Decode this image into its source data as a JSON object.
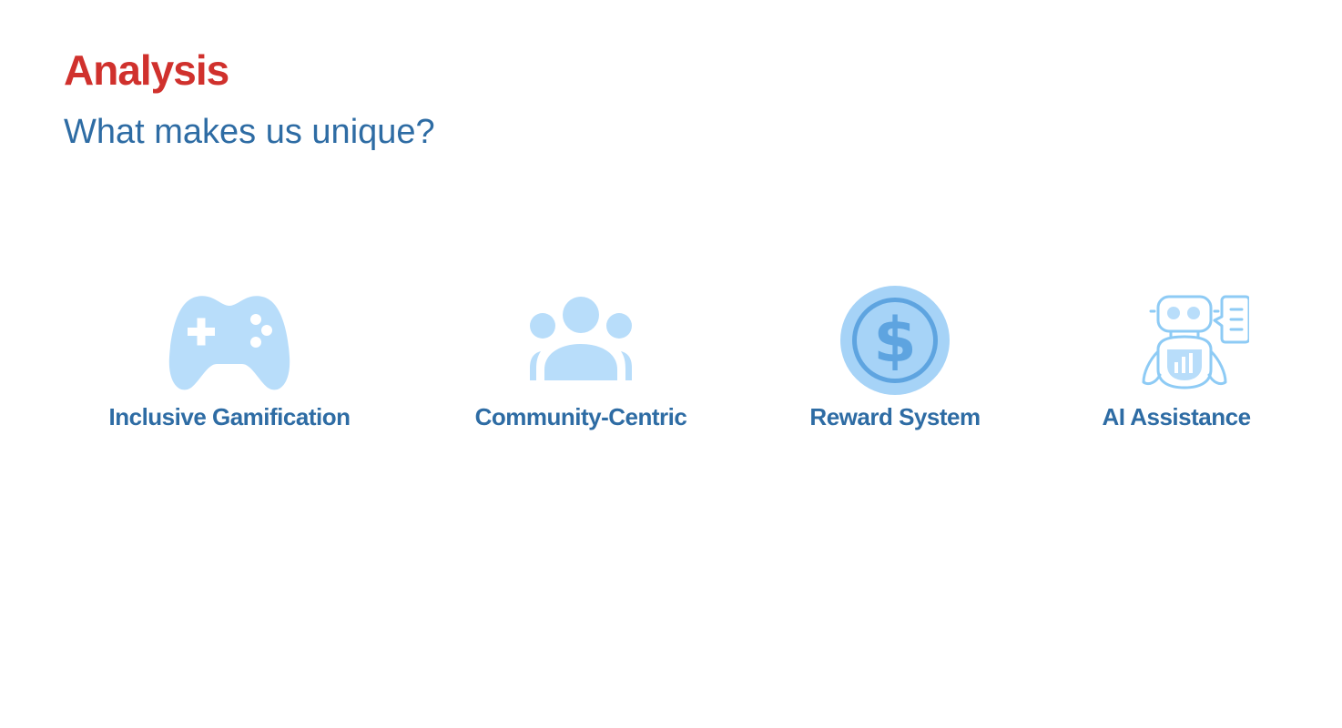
{
  "slide": {
    "title": "Analysis",
    "subtitle": "What makes us unique?"
  },
  "features": [
    {
      "label": "Inclusive Gamification",
      "icon": "game-controller-icon"
    },
    {
      "label": "Community-Centric",
      "icon": "group-icon"
    },
    {
      "label": "Reward System",
      "icon": "dollar-coin-icon"
    },
    {
      "label": "AI Assistance",
      "icon": "robot-assistant-icon"
    }
  ],
  "colors": {
    "title": "#d0312d",
    "text": "#2e6ca4",
    "icon_light": "#b8ddfa",
    "icon_mid": "#a6d3f7",
    "icon_dark": "#5ea4e0",
    "icon_outline": "#8ecbf5"
  }
}
